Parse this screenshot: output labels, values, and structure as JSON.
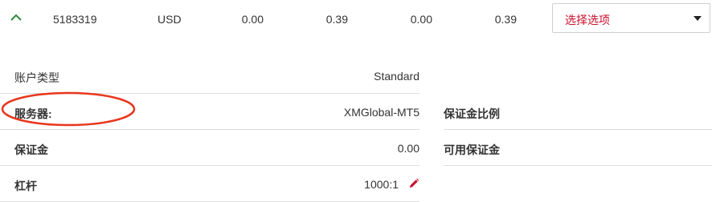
{
  "summary": {
    "account_id": "5183319",
    "currency": "USD",
    "value1": "0.00",
    "value2": "0.39",
    "value3": "0.00",
    "value4": "0.39",
    "select_label": "选择选项"
  },
  "details": {
    "account_type_label": "账户类型",
    "account_type_value": "Standard",
    "server_label": "服务器:",
    "server_value": "XMGlobal-MT5",
    "margin_label": "保证金",
    "margin_value": "0.00",
    "leverage_label": "杠杆",
    "leverage_value": "1000:1"
  },
  "right_details": {
    "margin_level_label": "保证金比例",
    "free_margin_label": "可用保证金"
  },
  "colors": {
    "accent_red": "#c8102e",
    "chevron_green": "#2e8b3a",
    "annotation_red": "#e8361c"
  },
  "icons": {
    "collapse": "chevron-up-icon",
    "edit": "pencil-icon",
    "dropdown": "caret-down-icon"
  }
}
